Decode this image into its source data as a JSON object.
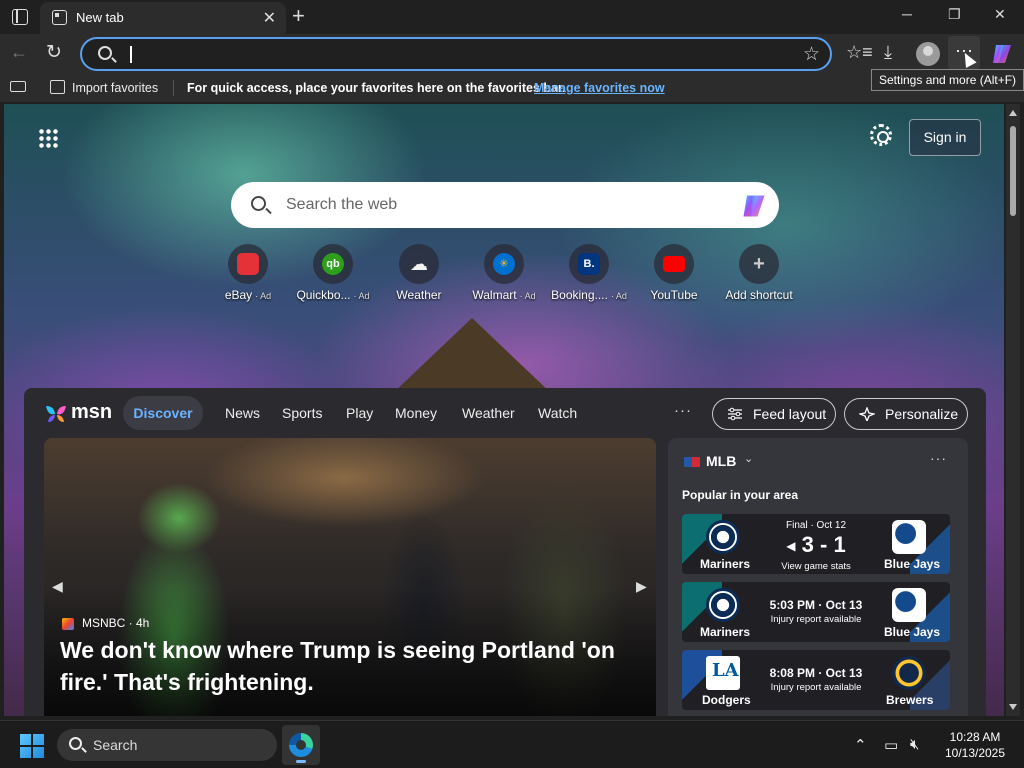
{
  "browser": {
    "tab_title": "New tab",
    "tab_close": "✕",
    "new_tab": "+",
    "window_controls": {
      "minimize": "─",
      "maximize": "❐",
      "close": "✕"
    },
    "back": "←",
    "refresh": "↻",
    "more_button": "···",
    "tooltip": "Settings and more (Alt+F)",
    "toolbar_icons": {
      "favorites": "☆≡",
      "downloads": "⤓"
    }
  },
  "favorites_bar": {
    "import_label": "Import favorites",
    "message": "For quick access, place your favorites here on the favorites bar.",
    "manage_link": "Manage favorites now"
  },
  "newtab": {
    "signin": "Sign in",
    "search_placeholder": "Search the web",
    "shortcuts": [
      {
        "label": "eBay",
        "ad": "· Ad",
        "icon": "ebay-icon",
        "color": "#e53238"
      },
      {
        "label": "Quickbo...",
        "ad": "· Ad",
        "icon": "quickbooks-icon",
        "color": "#2ca01c"
      },
      {
        "label": "Weather",
        "ad": "",
        "icon": "weather-icon",
        "color": "#f5b400"
      },
      {
        "label": "Walmart",
        "ad": "· Ad",
        "icon": "walmart-icon",
        "color": "#0071ce"
      },
      {
        "label": "Booking....",
        "ad": "· Ad",
        "icon": "booking-icon",
        "color": "#003580"
      },
      {
        "label": "YouTube",
        "ad": "",
        "icon": "youtube-icon",
        "color": "#ff0000"
      },
      {
        "label": "Add shortcut",
        "ad": "",
        "icon": "plus-icon",
        "color": "#555555"
      }
    ]
  },
  "feed": {
    "logo_text": "msn",
    "nav": [
      "Discover",
      "News",
      "Sports",
      "Play",
      "Money",
      "Weather",
      "Watch"
    ],
    "more": "···",
    "feed_layout": "Feed layout",
    "personalize": "Personalize",
    "hero": {
      "source": "MSNBC · 4h",
      "title": "We don't know where Trump is seeing Portland 'on fire.' That's frightening."
    },
    "mlb": {
      "title": "MLB",
      "more": "···",
      "subtitle": "Popular in your area",
      "games": [
        {
          "home": "Mariners",
          "away": "Blue Jays",
          "status": "Final · Oct 12",
          "score": "3 - 1",
          "link": "View game stats"
        },
        {
          "home": "Mariners",
          "away": "Blue Jays",
          "time": "5:03 PM · Oct 13",
          "note": "Injury report available"
        },
        {
          "home": "Dodgers",
          "away": "Brewers",
          "time": "8:08 PM · Oct 13",
          "note": "Injury report available"
        }
      ]
    }
  },
  "taskbar": {
    "search": "Search",
    "time": "10:28 AM",
    "date": "10/13/2025"
  }
}
